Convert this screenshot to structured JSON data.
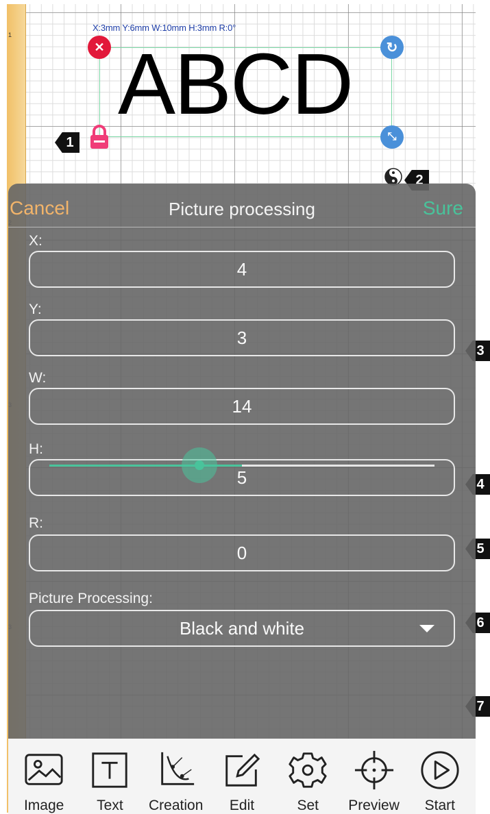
{
  "canvas": {
    "ruler_marks": [
      "1",
      "2",
      "3",
      "3"
    ],
    "size_readout": "X:3mm  Y:6mm  W:10mm  H:3mm  R:0°",
    "text_object": "ABCD",
    "handles": {
      "delete": "close-icon",
      "rotate": "rotate-icon",
      "resize": "resize-icon",
      "lock": "lock-icon"
    },
    "mode_icon": "yin-yang-icon"
  },
  "callouts": [
    "1",
    "2",
    "3",
    "4",
    "5",
    "6",
    "7"
  ],
  "dialog": {
    "cancel_label": "Cancel",
    "title": "Picture processing",
    "sure_label": "Sure",
    "fields": [
      {
        "label": "X:",
        "value": "4"
      },
      {
        "label": "Y:",
        "value": "3"
      },
      {
        "label": "W:",
        "value": "14"
      },
      {
        "label": "H:",
        "value": "5"
      },
      {
        "label": "R:",
        "value": "0"
      }
    ],
    "processing_label": "Picture Processing:",
    "processing_value": "Black and white",
    "slider_fraction": 0.5
  },
  "toolbar": [
    {
      "label": "Image",
      "icon": "image-icon"
    },
    {
      "label": "Text",
      "icon": "text-icon"
    },
    {
      "label": "Creation",
      "icon": "creation-icon"
    },
    {
      "label": "Edit",
      "icon": "edit-icon"
    },
    {
      "label": "Set",
      "icon": "gear-icon"
    },
    {
      "label": "Preview",
      "icon": "crosshair-icon"
    },
    {
      "label": "Start",
      "icon": "play-icon"
    }
  ],
  "colors": {
    "accent_green": "#49c39b",
    "cancel_orange": "#f2b46a",
    "delete_red": "#e2183a",
    "handle_blue": "#4a90d9"
  }
}
